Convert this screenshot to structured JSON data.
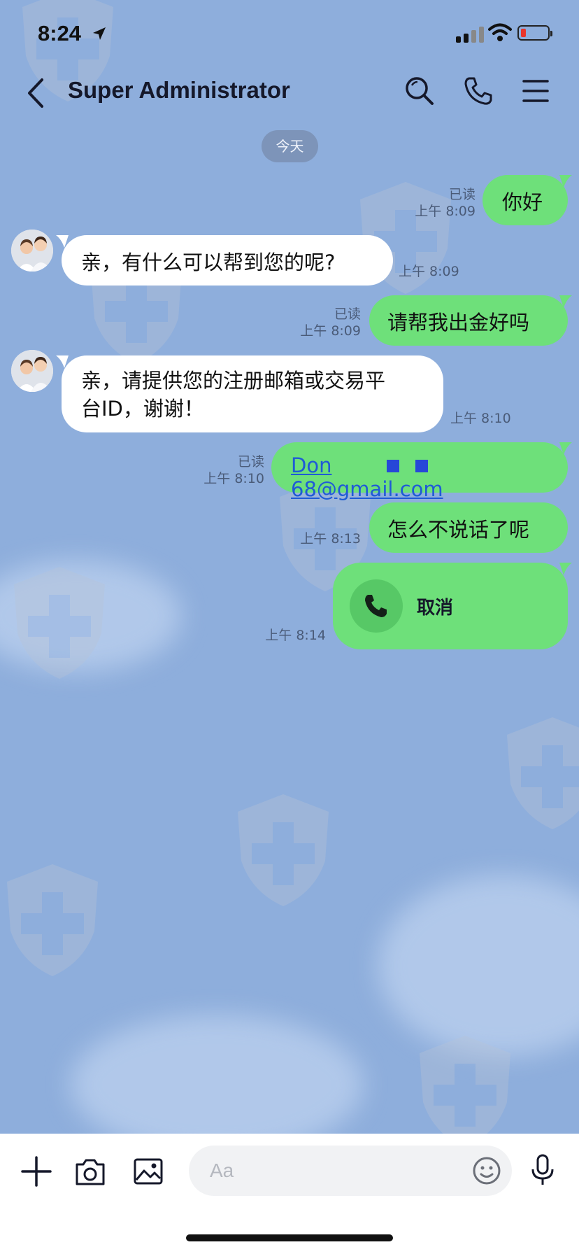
{
  "status_bar": {
    "time": "8:24"
  },
  "header": {
    "title": "Super Administrator"
  },
  "date_chip": "今天",
  "messages": [
    {
      "side": "out",
      "text": "你好",
      "read": "已读",
      "time": "上午 8:09"
    },
    {
      "side": "in",
      "text": "亲，有什么可以帮到您的呢?",
      "time": "上午 8:09"
    },
    {
      "side": "out",
      "text": "请帮我出金好吗",
      "read": "已读",
      "time": "上午 8:09"
    },
    {
      "side": "in",
      "line1": "亲，请提供您的注册邮箱或交易平",
      "line2": "台ID，谢谢！",
      "time": "上午 8:10"
    },
    {
      "side": "out",
      "email_start": "Don",
      "email_end": "68@gmail.com",
      "read": "已读",
      "time": "上午 8:10"
    },
    {
      "side": "out",
      "text": "怎么不说话了呢",
      "time": "上午 8:13"
    },
    {
      "side": "out",
      "call_label": "取消",
      "time": "上午 8:14"
    }
  ],
  "input": {
    "placeholder": "Aa"
  },
  "icons": {
    "back": "chevron-left-icon",
    "search": "search-icon",
    "call": "phone-icon",
    "menu": "menu-icon",
    "add": "plus-icon",
    "camera": "camera-icon",
    "image": "image-icon",
    "emoji": "emoji-icon",
    "mic": "microphone-icon"
  },
  "colors": {
    "background": "#8eaedc",
    "bubble_out": "#6ee07a",
    "bubble_in": "#ffffff",
    "link": "#1f5bd6",
    "battery_low": "#e8352c"
  }
}
